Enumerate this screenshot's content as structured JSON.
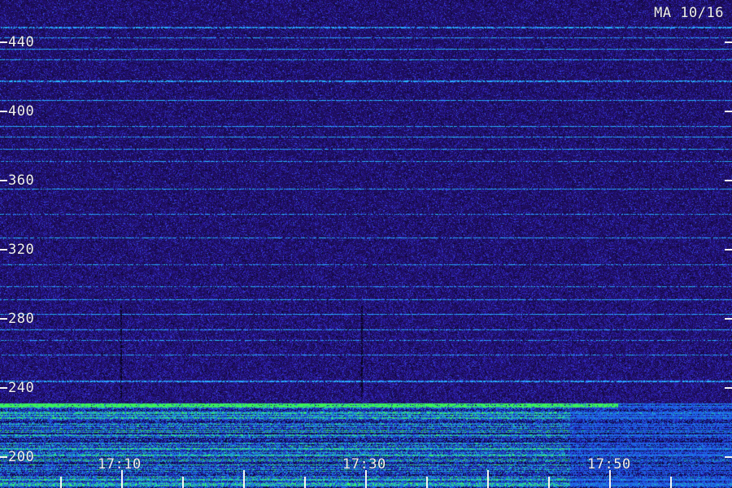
{
  "station_label": "MA 10/16",
  "y_axis": {
    "ticks": [
      440,
      400,
      360,
      320,
      280,
      240,
      200
    ]
  },
  "x_axis": {
    "labels": [
      "17:10",
      "17:30",
      "17:50"
    ]
  },
  "colors": {
    "background": "#241066",
    "speckle_blue": "#3a5cff",
    "line_cyan": "#38b8ff",
    "band_green": "#33ee66",
    "band_teal": "#1aa6c8",
    "axis_text": "#f2f2f2"
  }
}
